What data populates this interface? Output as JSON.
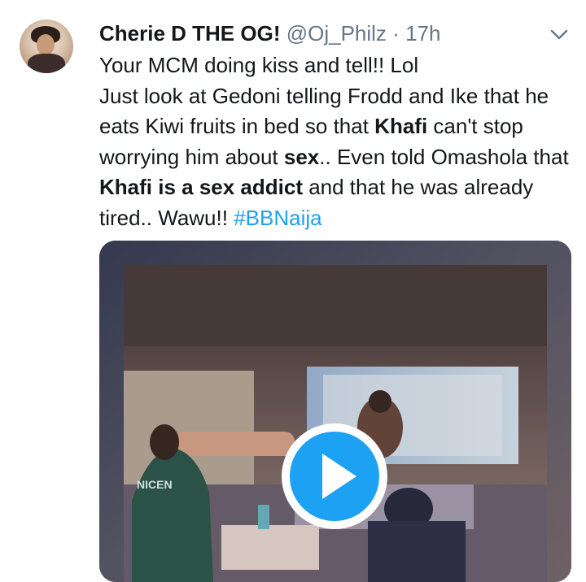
{
  "tweet": {
    "author": {
      "display_name": "Cherie D THE OG!",
      "handle": "@Oj_Philz"
    },
    "separator": "·",
    "time": "17h",
    "text": {
      "line1": "Your MCM doing kiss and tell!! Lol",
      "p2_a": "Just look at Gedoni telling Frodd and Ike that he eats Kiwi fruits in bed so that ",
      "p2_b1": "Khafi",
      "p2_c": " can't stop worrying him about ",
      "p2_b2": "sex",
      "p2_d": ".. Even told Omashola that ",
      "p2_b3": "Khafi is a sex addict",
      "p2_e": " and that he was already tired.. Wawu!! ",
      "hashtag": "#BBNaija"
    },
    "media": {
      "type": "video",
      "play_icon": "play-icon",
      "shirt_text": "NICEN"
    }
  },
  "icons": {
    "more": "chevron-down-icon"
  },
  "colors": {
    "link": "#1da1f2",
    "secondary_text": "#657786",
    "primary_text": "#14171a",
    "play_button": "#1da1f2"
  }
}
